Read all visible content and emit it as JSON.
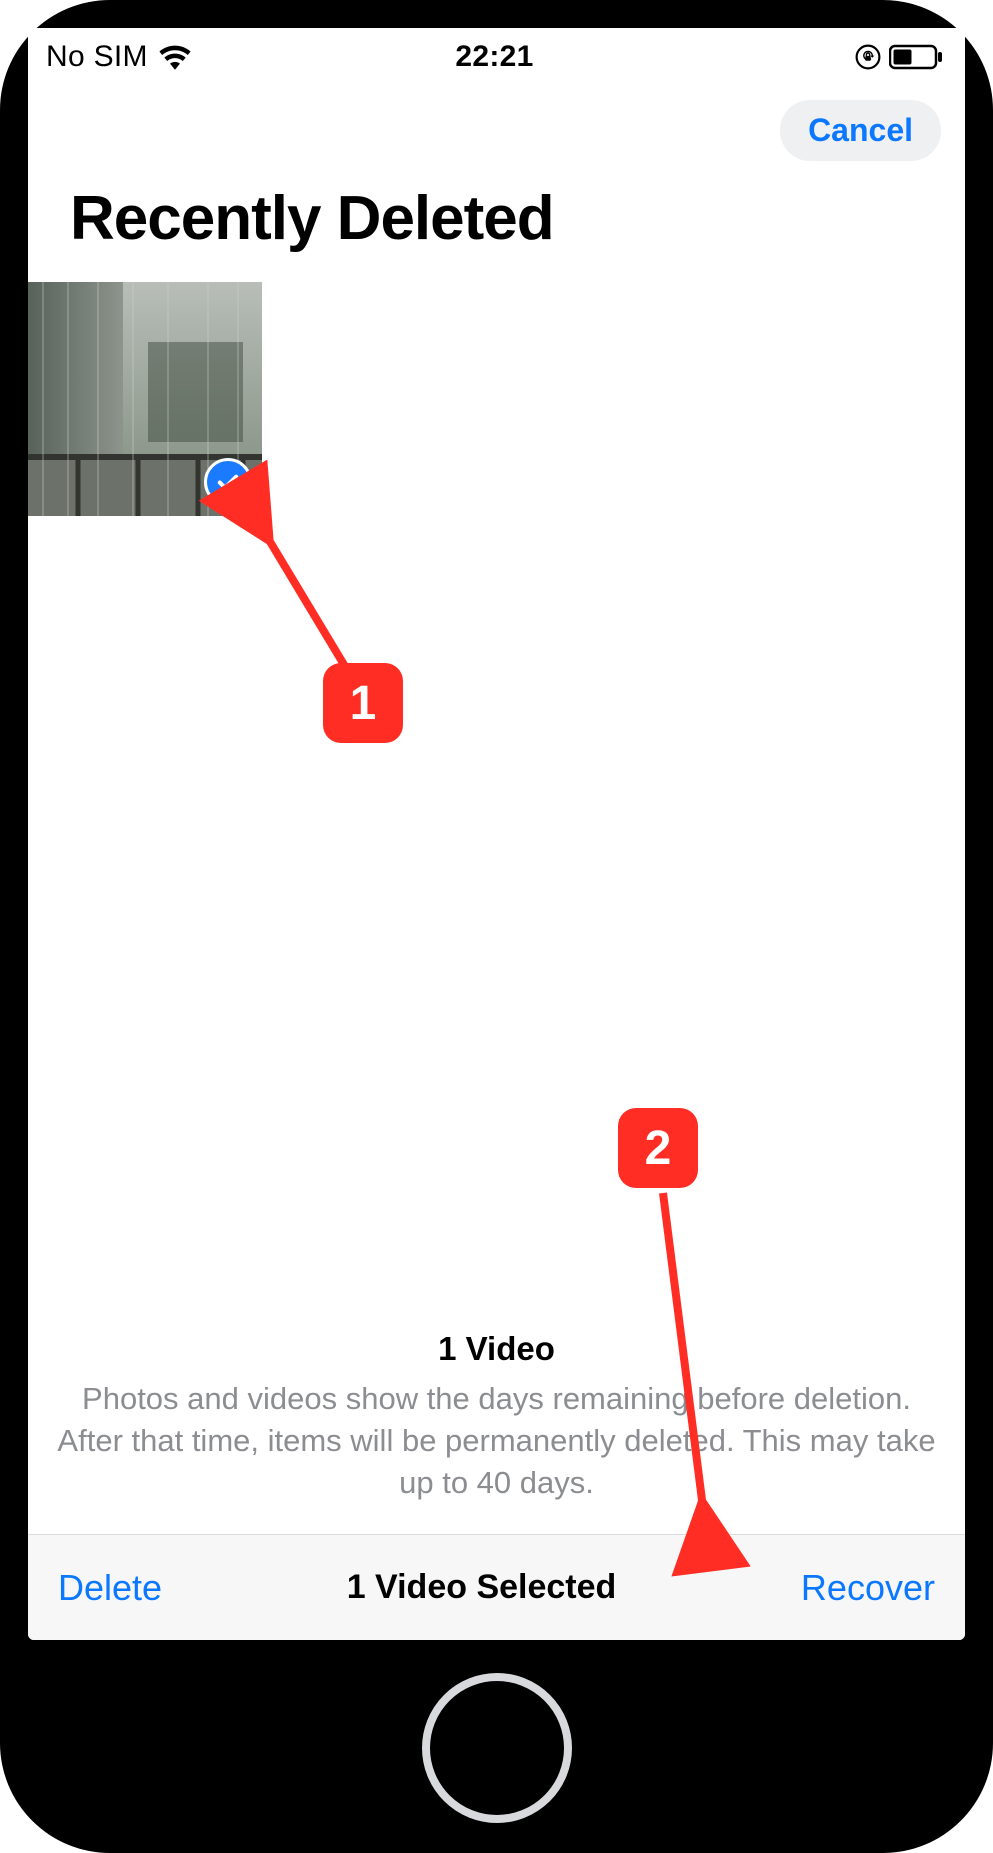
{
  "status": {
    "carrier": "No SIM",
    "time": "22:21"
  },
  "nav": {
    "cancel": "Cancel"
  },
  "page": {
    "title": "Recently Deleted"
  },
  "info": {
    "count": "1 Video",
    "description": "Photos and videos show the days remaining before deletion. After that time, items will be permanently deleted. This may take up to 40 days."
  },
  "toolbar": {
    "delete": "Delete",
    "selection": "1 Video Selected",
    "recover": "Recover"
  },
  "annotations": {
    "one": "1",
    "two": "2"
  }
}
